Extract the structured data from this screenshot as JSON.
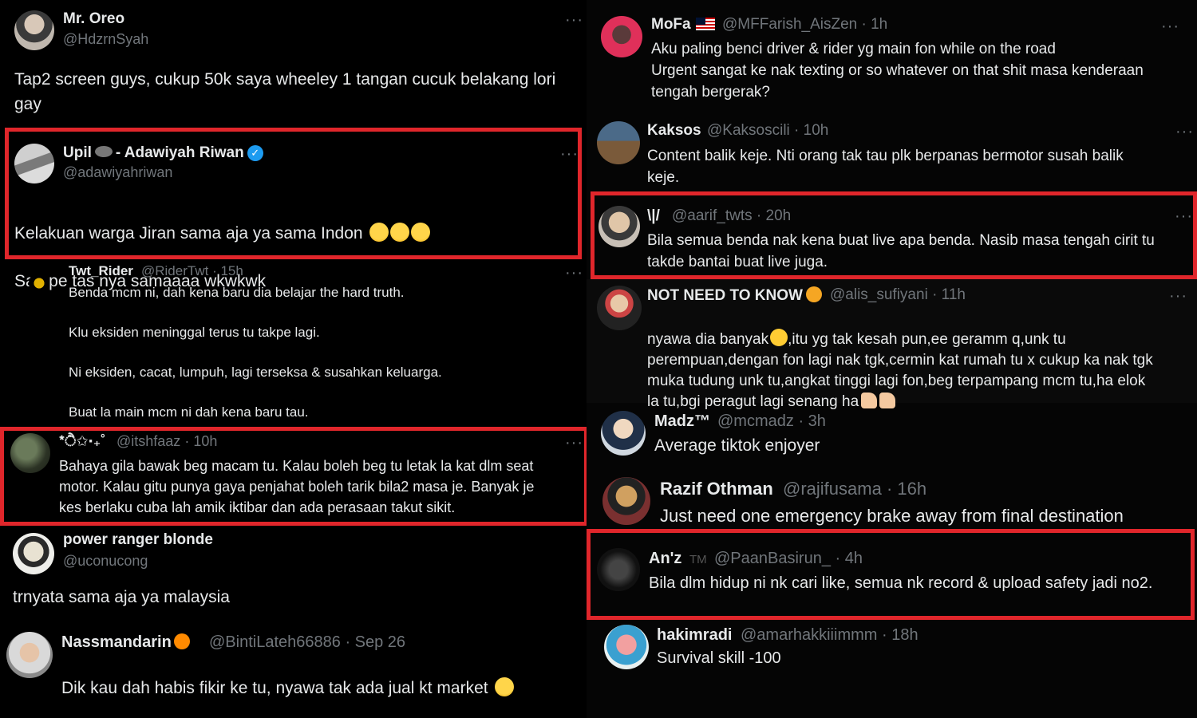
{
  "left": {
    "tweets": [
      {
        "name": "Mr. Oreo",
        "handle": "@HdzrnSyah",
        "text": "Tap2 screen guys, cukup 50k saya wheeley 1 tangan cucuk belakang lori gay"
      },
      {
        "name": "Upil",
        "name_suffix": "- Adawiyah Riwan",
        "handle": "@adawiyahriwan",
        "text": "Kelakuan warga Jiran sama aja ya sama Indon",
        "text2": "Sampe tas nya samaaaa wkwkwk"
      },
      {
        "name": "Twt_Rider",
        "handle": "@RiderTwt",
        "time": "· 15h",
        "lines": [
          "Benda mcm ni, dah kena baru dia belajar the hard truth.",
          "Klu eksiden meninggal terus tu takpe lagi.",
          "Ni eksiden, cacat, lumpuh, lagi terseksa & susahkan keluarga.",
          "Buat la main mcm ni dah kena baru tau."
        ]
      },
      {
        "name": "*ੈ✩‧₊˚",
        "handle": "@itshfaaz",
        "time": "· 10h",
        "text": "Bahaya gila bawak beg macam tu. Kalau boleh beg tu letak la kat dlm seat\nmotor. Kalau gitu punya gaya penjahat boleh tarik bila2 masa je. Banyak je\nkes berlaku cuba lah amik iktibar dan ada perasaan takut sikit."
      },
      {
        "name": "power ranger blonde",
        "handle": "@uconucong",
        "text": "trnyata sama aja ya malaysia"
      },
      {
        "name": "Nassmandarin",
        "handle": "@BintiLateh66886",
        "time": "· Sep 26",
        "text": "Dik kau dah habis fikir ke tu, nyawa tak ada jual kt market"
      }
    ]
  },
  "right": {
    "tweets": [
      {
        "name": "MoFa",
        "handle": "@MFFarish_AisZen",
        "time": "· 1h",
        "text": "Aku paling benci driver & rider yg main fon while on the road\nUrgent sangat ke nak texting or so whatever on that shit masa kenderaan\ntengah bergerak?"
      },
      {
        "name": "Kaksos",
        "handle": "@Kaksoscili",
        "time": "· 10h",
        "text": "Content balik keje. Nti orang tak tau plk berpanas bermotor susah balik\nkeje."
      },
      {
        "name": "\\|/",
        "handle": "@aarif_twts",
        "time": "· 20h",
        "text": "Bila semua benda nak kena buat live apa benda. Nasib masa tengah cirit tu\ntakde bantai buat live juga."
      },
      {
        "name": "NOT NEED TO KNOW",
        "handle": "@alis_sufiyani",
        "time": "· 11h",
        "text_a": "nyawa dia banyak",
        "text_b": ",itu yg tak kesah pun,ee geramm q,unk tu\nperempuan,dengan fon lagi nak tgk,cermin kat rumah tu x cukup ka nak tgk\nmuka tudung unk tu,angkat tinggi lagi fon,beg terpampang mcm tu,ha elok\nla tu,bgi peragut lagi senang ha"
      },
      {
        "name": "Madz™",
        "handle": "@mcmadz",
        "time": "· 3h",
        "text": "Average tiktok enjoyer"
      },
      {
        "name": "Razif Othman",
        "handle": "@rajifusama",
        "time": "· 16h",
        "text": "Just need one emergency brake away from final destination"
      },
      {
        "name": "An'z",
        "name_tm": "TM",
        "handle": "@PaanBasirun_",
        "time": "· 4h",
        "text": "Bila dlm hidup ni nk cari like, semua nk record & upload safety jadi no2."
      },
      {
        "name": "hakimradi",
        "handle": "@amarhakkiiimmm",
        "time": "· 18h",
        "text": "Survival skill -100"
      }
    ]
  },
  "ui": {
    "more_glyph": "···",
    "verified_glyph": "✓"
  },
  "colors": {
    "highlight": "#e0262b",
    "background": "#000000",
    "text": "#e7e9ea",
    "muted": "#71767b",
    "verified": "#1d9bf0"
  }
}
